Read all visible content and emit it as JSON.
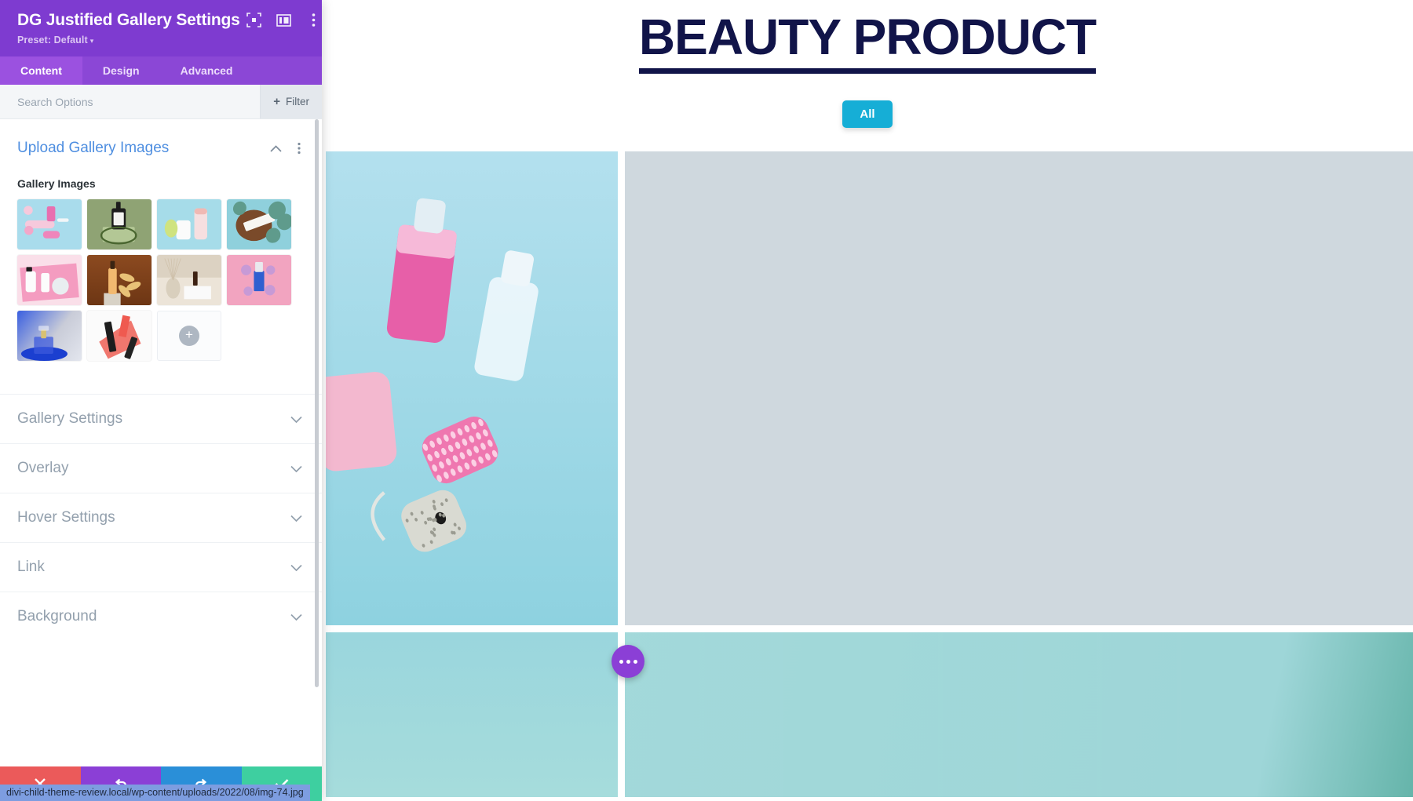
{
  "panel": {
    "title": "DG Justified Gallery Settings",
    "preset_label": "Preset: Default",
    "preset_caret": "▾",
    "header_icons": [
      {
        "name": "focus-target-icon",
        "label": "Focus"
      },
      {
        "name": "layout-panel-icon",
        "label": "Layout"
      },
      {
        "name": "vertical-dots-icon",
        "label": "More options"
      }
    ],
    "tabs": [
      {
        "label": "Content",
        "active": true
      },
      {
        "label": "Design",
        "active": false
      },
      {
        "label": "Advanced",
        "active": false
      }
    ],
    "search": {
      "value": "",
      "placeholder": "Search Options"
    },
    "filter_button": {
      "plus": "+",
      "label": "Filter"
    },
    "open_section": {
      "title": "Upload Gallery Images",
      "field_label": "Gallery Images",
      "thumbnails": [
        {
          "alt": "pink-cosmetic-bottles-on-blue",
          "bg": "#a8dced",
          "theme": "pinkblue"
        },
        {
          "alt": "black-pump-bottle-on-green",
          "bg": "#93a87a",
          "theme": "greenpump"
        },
        {
          "alt": "white-jar-and-tube-on-teal",
          "bg": "#a5dbe8",
          "theme": "tealjar"
        },
        {
          "alt": "cream-jar-with-eucalyptus",
          "bg": "#8fcdd8",
          "theme": "coconut"
        },
        {
          "alt": "white-bottles-on-pink",
          "bg": "#f7c9da",
          "theme": "pinkflat"
        },
        {
          "alt": "serum-bottle-on-brown",
          "bg": "#8a4a22",
          "theme": "brown"
        },
        {
          "alt": "reed-diffuser-on-beige",
          "bg": "#e8e0d4",
          "theme": "beige"
        },
        {
          "alt": "blue-bottle-on-pink",
          "bg": "#f0a9c2",
          "theme": "pinkblue2"
        },
        {
          "alt": "blue-perfume-bottle",
          "bg": "#2b4fd0",
          "theme": "blueperfume"
        },
        {
          "alt": "red-lipstick-swatch",
          "bg": "#fbfbfb",
          "theme": "lipstick"
        }
      ],
      "add_button": {
        "glyph": "+",
        "label": "Add gallery image"
      }
    },
    "accordion_sections": [
      {
        "label": "Gallery Settings"
      },
      {
        "label": "Overlay"
      },
      {
        "label": "Hover Settings"
      },
      {
        "label": "Link"
      },
      {
        "label": "Background"
      }
    ],
    "actions": [
      {
        "name": "discard-button",
        "icon": "close-icon",
        "color": "#eb5a5a"
      },
      {
        "name": "undo-button",
        "icon": "undo-icon",
        "color": "#8b3fd6"
      },
      {
        "name": "redo-button",
        "icon": "redo-icon",
        "color": "#2a8fd8"
      },
      {
        "name": "save-button",
        "icon": "check-icon",
        "color": "#3ecfa0"
      }
    ]
  },
  "status_bar": {
    "url": "divi-child-theme-review.local/wp-content/uploads/2022/08/img-74.jpg"
  },
  "preview": {
    "heading": "BEAUTY PRODUCT",
    "heading_color": "#111449",
    "filters": [
      {
        "label": "All",
        "active": true,
        "color": "#16aed6"
      }
    ],
    "gallery": [
      {
        "alt": "blue-bathroom-set-sanitizer-brush",
        "theme": "bathset"
      },
      {
        "alt": "dark-overlay-pump-bottle",
        "theme": "darkpump"
      },
      {
        "alt": "teal-product-right",
        "theme": "tealplain"
      },
      {
        "alt": "teal-bottom-left",
        "theme": "tealplain2"
      },
      {
        "alt": "teal-bottom-center",
        "theme": "tealplain3"
      },
      {
        "alt": "teal-bottom-right",
        "theme": "tealplain4"
      }
    ],
    "fab": {
      "name": "settings-fab",
      "glyph": "•••",
      "color": "#8b3fd6"
    }
  }
}
